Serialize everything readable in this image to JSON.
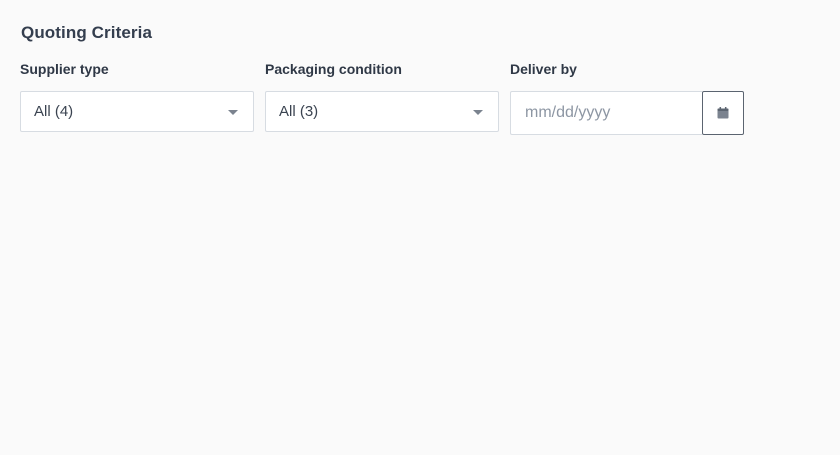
{
  "section": {
    "title": "Quoting Criteria"
  },
  "filters": {
    "supplier_type": {
      "label": "Supplier type",
      "value": "All (4)"
    },
    "packaging_condition": {
      "label": "Packaging condition",
      "value": "All (3)"
    },
    "deliver_by": {
      "label": "Deliver by",
      "placeholder": "mm/dd/yyyy",
      "value": ""
    }
  },
  "icons": {
    "select_caret": "chevron-down-icon",
    "date_picker": "calendar-icon"
  },
  "colors": {
    "background": "#fafafa",
    "border": "#d7dce2",
    "icon": "#7b838f"
  }
}
